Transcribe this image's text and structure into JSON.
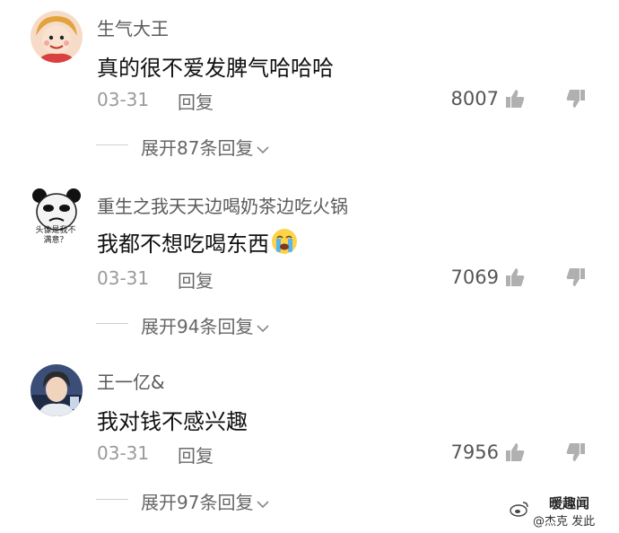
{
  "comments": [
    {
      "username": "生气大王",
      "content": "真的很不爱发脾气哈哈哈",
      "date": "03-31",
      "reply_label": "回复",
      "likes": "8007",
      "expand_label": "展开87条回复",
      "avatar": "cartoon-girl-avatar"
    },
    {
      "username": "重生之我天天边喝奶茶边吃火锅",
      "content": "我都不想吃喝东西",
      "emoji": "crying-face-emoji",
      "date": "03-31",
      "reply_label": "回复",
      "likes": "7069",
      "expand_label": "展开94条回复",
      "avatar": "panda-meme-avatar",
      "avatar_caption": "头像是我不满意？"
    },
    {
      "username": "王一亿&",
      "content": "我对钱不感兴趣",
      "date": "03-31",
      "reply_label": "回复",
      "likes": "7956",
      "expand_label": "展开97条回复",
      "avatar": "young-man-photo-avatar"
    }
  ],
  "watermark": {
    "line1": "暖趣闻",
    "line2": "@杰克 发此"
  },
  "colors": {
    "username": "#5a5a5a",
    "content": "#111111",
    "meta": "#9a9a9a",
    "icon": "#b0b0b0"
  }
}
